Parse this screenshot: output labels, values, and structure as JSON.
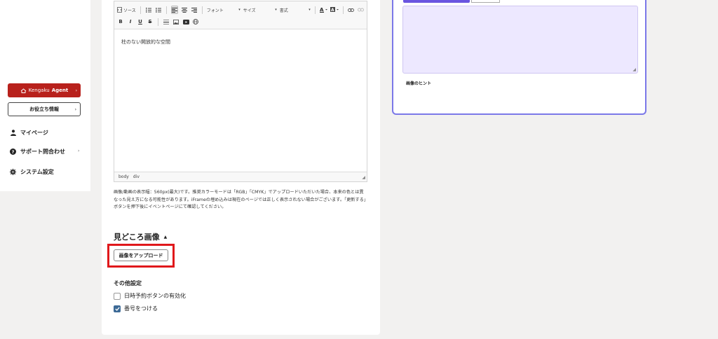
{
  "sidebar": {
    "agent_button": {
      "label_light": "Kengaku",
      "label_bold": "Agent",
      "chevron": "›",
      "color": "#b8211c"
    },
    "info_button": {
      "label": "お役立ち情報",
      "chevron": "›"
    },
    "items": [
      {
        "label": "マイページ",
        "icon": "user-icon"
      },
      {
        "label": "サポート問合わせ",
        "icon": "question-icon",
        "chevron": "›"
      },
      {
        "label": "システム設定",
        "icon": "gear-icon"
      }
    ]
  },
  "editor": {
    "toolbar": {
      "source_label": "ソース",
      "font_label": "フォント",
      "size_label": "サイズ",
      "format_label": "書式",
      "bold": "B",
      "italic": "I",
      "underline": "U",
      "strike": "S"
    },
    "content": "柱のない開放的な空間",
    "footer_path": [
      "body",
      "div"
    ]
  },
  "note_text": "画像/動画の表示幅：560px(最大)です。推奨カラーモードは「RGB」「CMYK」でアップロードいただいた場合、本来の色とは異なった見え方になる可能性があります。iFrameの埋め込みは現在のページでは正しく表示されない場合がございます。「更新する」ボタンを押下後にイベントページにて確認してください。",
  "highlights_section": {
    "title": "見どころ画像",
    "caret": "▲",
    "upload_button": "画像をアップロード",
    "highlight_color": "#e0181b"
  },
  "other_settings": {
    "title": "その他設定",
    "options": [
      {
        "label": "日時予約ボタンの有効化",
        "checked": false
      },
      {
        "label": "番号をつける",
        "checked": true
      }
    ]
  },
  "right_panel": {
    "hint_label": "画像のヒント",
    "accent": "#6a55e0"
  }
}
